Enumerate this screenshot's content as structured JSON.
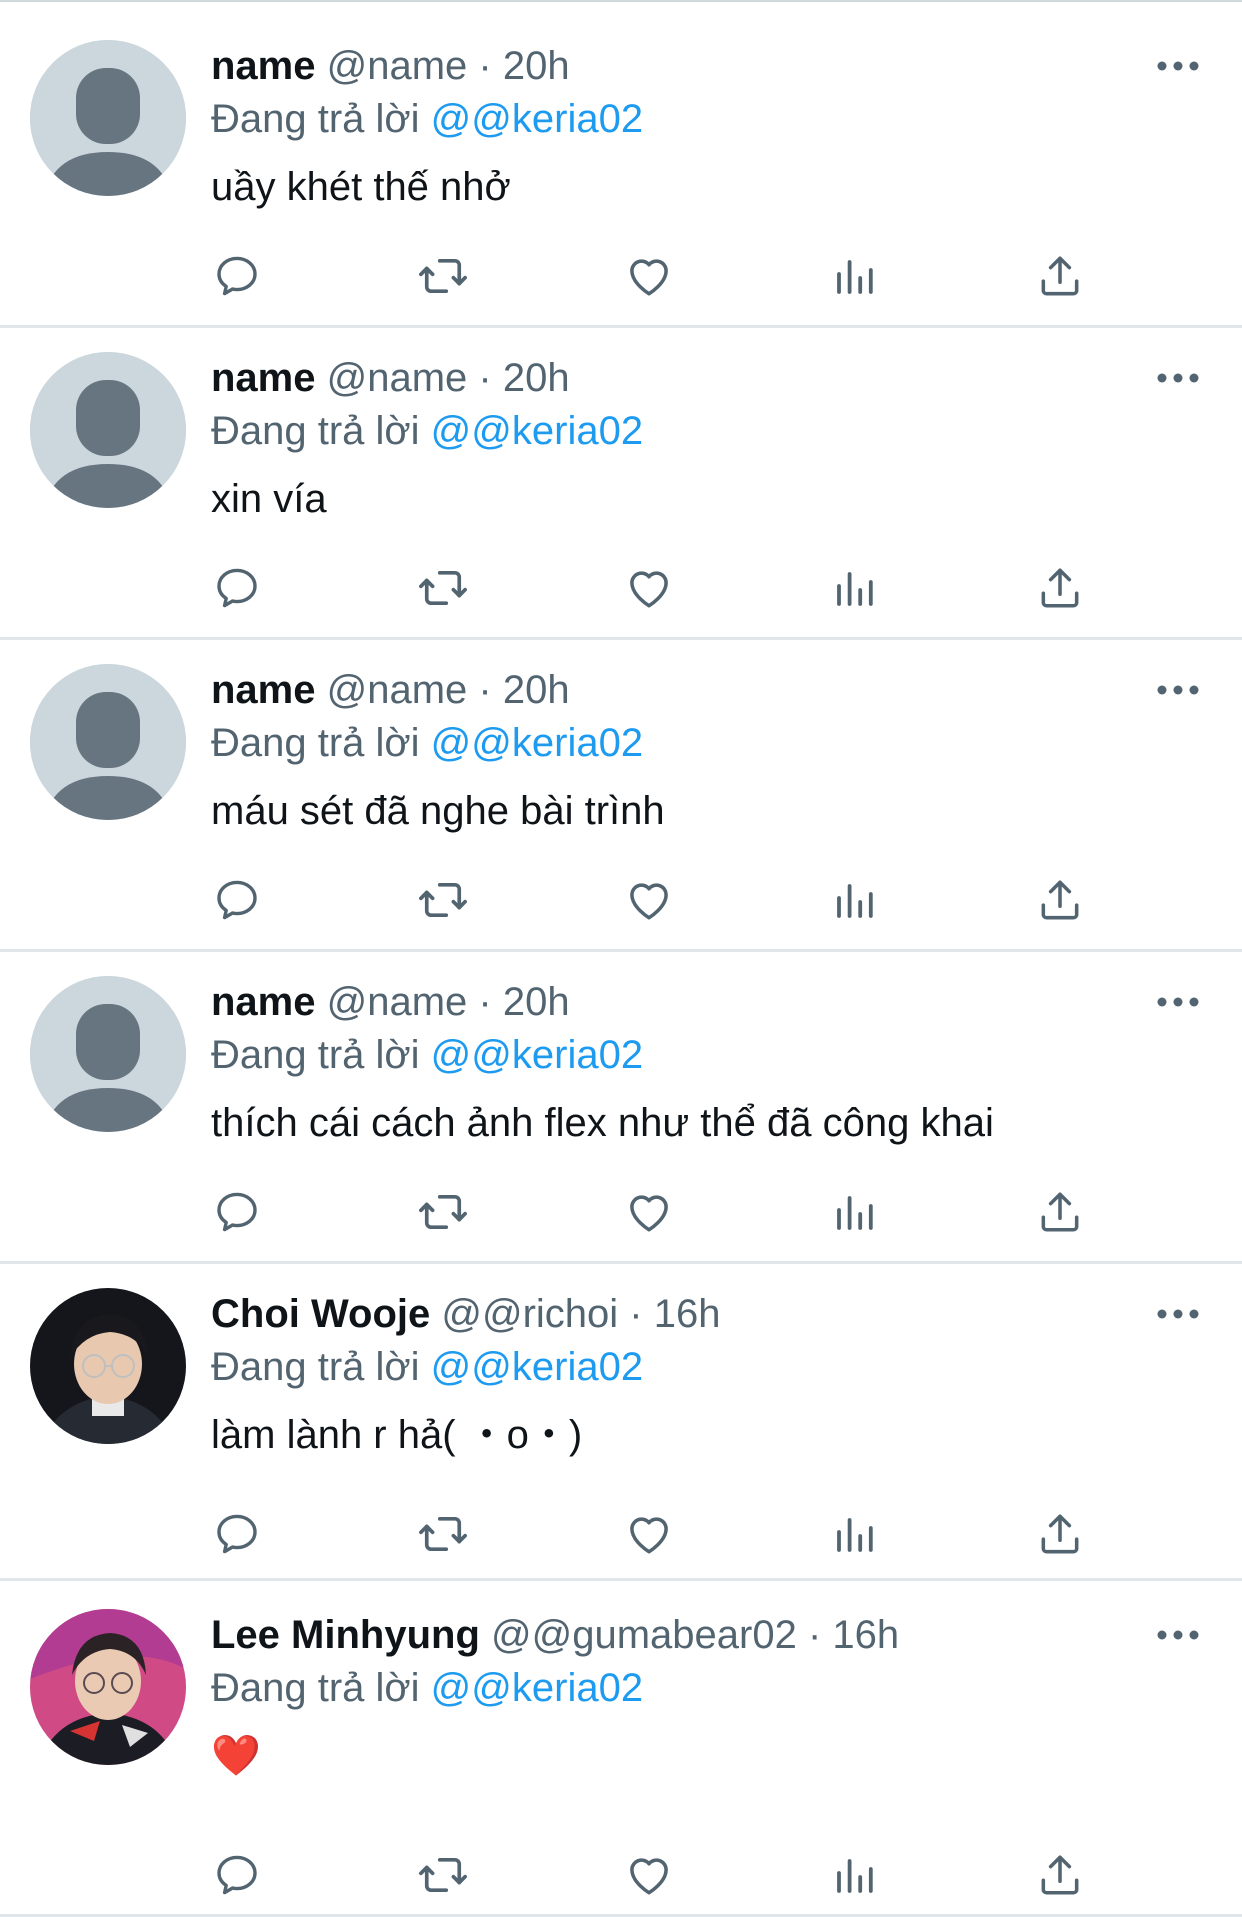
{
  "colors": {
    "accent": "#1d9bf0",
    "secondary_text": "#536471",
    "icon": "#536471",
    "avatar_placeholder": "#ccd6dd"
  },
  "replies": [
    {
      "display_name": "name",
      "handle": "@name",
      "separator": "·",
      "time": "20h",
      "replying_label": "Đang trả lời",
      "mention": "@@keria02",
      "text": "uầy khét thế nhở",
      "avatar": "default-avatar"
    },
    {
      "display_name": "name",
      "handle": "@name",
      "separator": "·",
      "time": "20h",
      "replying_label": "Đang trả lời",
      "mention": "@@keria02",
      "text": "xin vía",
      "avatar": "default-avatar"
    },
    {
      "display_name": "name",
      "handle": "@name",
      "separator": "·",
      "time": "20h",
      "replying_label": "Đang trả lời",
      "mention": "@@keria02",
      "text": "máu sét đã nghe bài trình",
      "avatar": "default-avatar"
    },
    {
      "display_name": "name",
      "handle": "@name",
      "separator": "·",
      "time": "20h",
      "replying_label": "Đang trả lời",
      "mention": "@@keria02",
      "text": "thích cái cách ảnh flex như thể đã công khai",
      "avatar": "default-avatar"
    },
    {
      "display_name": "Choi Wooje",
      "handle": "@@richoi",
      "separator": "·",
      "time": "16h",
      "replying_label": "Đang trả lời",
      "mention": "@@keria02",
      "text": "làm lành r hả( ・o・)",
      "avatar": "photo-avatar"
    },
    {
      "display_name": "Lee Minhyung",
      "handle": "@@gumabear02",
      "separator": "·",
      "time": "16h",
      "replying_label": "Đang trả lời",
      "mention": "@@keria02",
      "text": "❤️",
      "avatar": "photo-avatar"
    }
  ],
  "actions": [
    "reply-icon",
    "retweet-icon",
    "like-icon",
    "views-icon",
    "share-icon"
  ],
  "more_icon": "more-horizontal-icon"
}
